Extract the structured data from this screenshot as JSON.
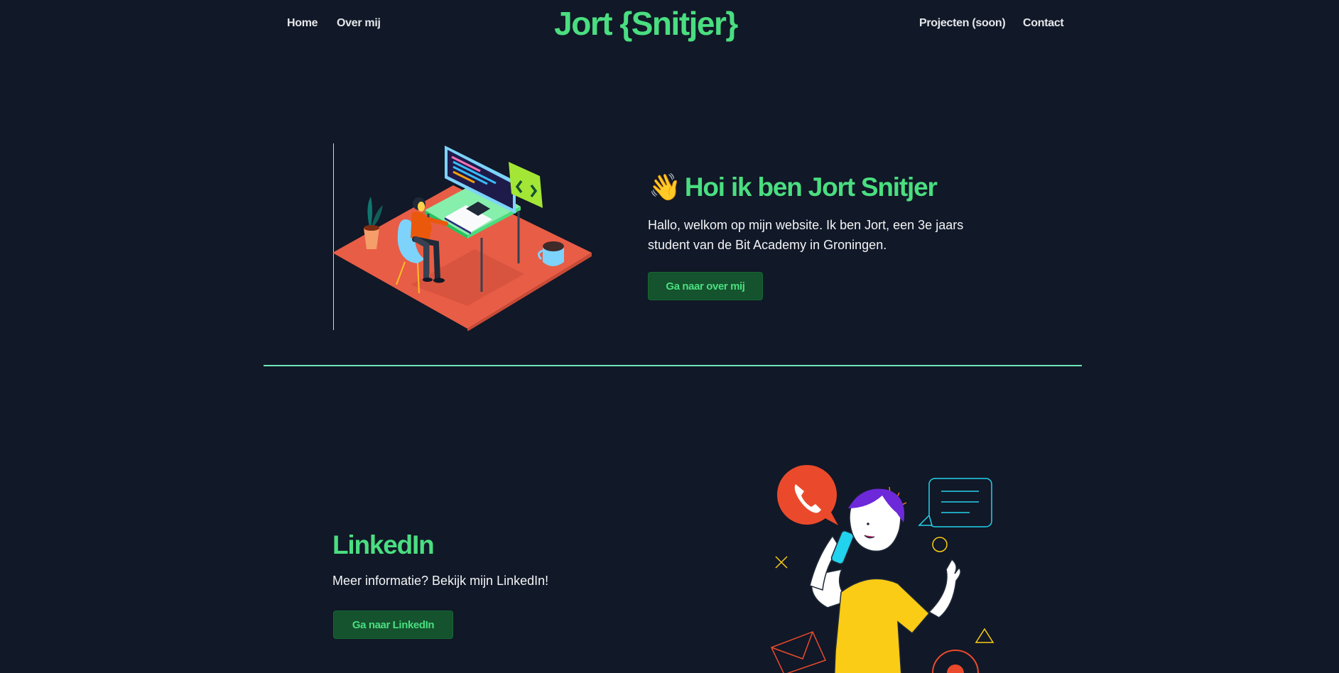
{
  "nav": {
    "home": "Home",
    "about": "Over mij",
    "brand": "Jort {Snitjer}",
    "projects": "Projecten (soon)",
    "contact": "Contact"
  },
  "hero": {
    "wave_emoji": "👋",
    "title": "Hoi ik ben Jort Snitjer",
    "text": "Hallo, welkom op mijn website. Ik ben Jort, een 3e jaars student van de Bit Academy in Groningen.",
    "button": "Ga naar over mij"
  },
  "linkedin": {
    "title": "LinkedIn",
    "text": "Meer informatie? Bekijk mijn LinkedIn!",
    "button": "Ga naar LinkedIn"
  },
  "colors": {
    "background": "#111827",
    "accent": "#4ade80",
    "button_bg": "#14532d",
    "divider": "#6ee7b7"
  }
}
